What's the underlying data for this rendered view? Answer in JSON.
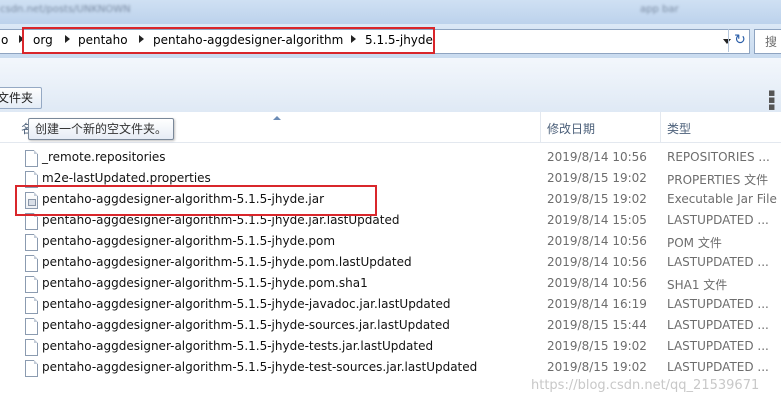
{
  "title_bar": {
    "blurred_left": "csdn.net/posts/UNKNOWN",
    "blurred_right": "app bar"
  },
  "address_bar": {
    "crumbs": [
      "o",
      "org",
      "pentaho",
      "pentaho-aggdesigner-algorithm",
      "5.1.5-jhyde"
    ],
    "refresh_icon": "refresh-icon",
    "search_placeholder": "搜"
  },
  "toolbar": {
    "new_folder_label": "文件夹",
    "tooltip": "创建一个新的空文件夹。"
  },
  "columns": {
    "name": "名",
    "modified": "修改日期",
    "type": "类型"
  },
  "files": [
    {
      "name": "_remote.repositories",
      "date": "2019/8/14 10:56",
      "type": "REPOSITORIES ..."
    },
    {
      "name": "m2e-lastUpdated.properties",
      "date": "2019/8/15 19:02",
      "type": "PROPERTIES 文件"
    },
    {
      "name": "pentaho-aggdesigner-algorithm-5.1.5-jhyde.jar",
      "date": "2019/8/15 19:02",
      "type": "Executable Jar File"
    },
    {
      "name": "pentaho-aggdesigner-algorithm-5.1.5-jhyde.jar.lastUpdated",
      "date": "2019/8/14 15:05",
      "type": "LASTUPDATED ..."
    },
    {
      "name": "pentaho-aggdesigner-algorithm-5.1.5-jhyde.pom",
      "date": "2019/8/14 10:56",
      "type": "POM 文件"
    },
    {
      "name": "pentaho-aggdesigner-algorithm-5.1.5-jhyde.pom.lastUpdated",
      "date": "2019/8/14 10:56",
      "type": "LASTUPDATED ..."
    },
    {
      "name": "pentaho-aggdesigner-algorithm-5.1.5-jhyde.pom.sha1",
      "date": "2019/8/14 10:56",
      "type": "SHA1 文件"
    },
    {
      "name": "pentaho-aggdesigner-algorithm-5.1.5-jhyde-javadoc.jar.lastUpdated",
      "date": "2019/8/14 16:19",
      "type": "LASTUPDATED ..."
    },
    {
      "name": "pentaho-aggdesigner-algorithm-5.1.5-jhyde-sources.jar.lastUpdated",
      "date": "2019/8/15 15:44",
      "type": "LASTUPDATED ..."
    },
    {
      "name": "pentaho-aggdesigner-algorithm-5.1.5-jhyde-tests.jar.lastUpdated",
      "date": "2019/8/15 19:02",
      "type": "LASTUPDATED ..."
    },
    {
      "name": "pentaho-aggdesigner-algorithm-5.1.5-jhyde-test-sources.jar.lastUpdated",
      "date": "2019/8/15 19:02",
      "type": "LASTUPDATED ..."
    }
  ],
  "watermark": "https://blog.csdn.net/qq_21539671",
  "colors": {
    "highlight_red": "#d9262b",
    "chrome_blue": "#c9dbef"
  }
}
